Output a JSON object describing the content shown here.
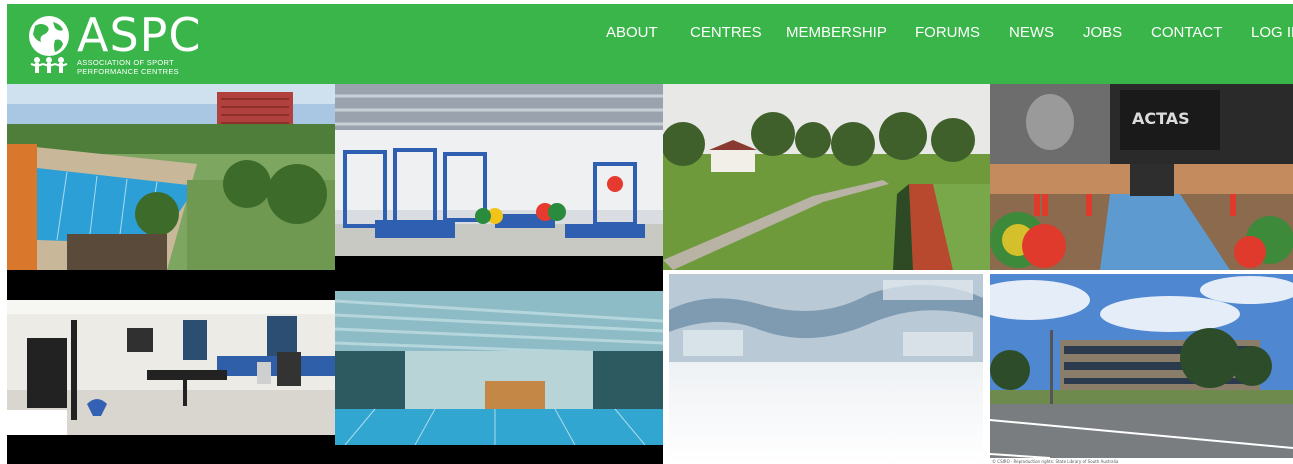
{
  "brand": {
    "name": "ASPC",
    "tagline_line1": "ASSOCIATION OF SPORT",
    "tagline_line2": "PERFORMANCE CENTRES",
    "color": "#39b54a"
  },
  "nav": {
    "items": [
      "ABOUT",
      "CENTRES",
      "MEMBERSHIP",
      "FORUMS",
      "NEWS",
      "JOBS",
      "CONTACT",
      "LOG IN"
    ]
  },
  "gallery": {
    "gym_sign": "ACTAS",
    "map_caption": "© CSIRO · Reproduction rights: State Library of South Australia"
  }
}
